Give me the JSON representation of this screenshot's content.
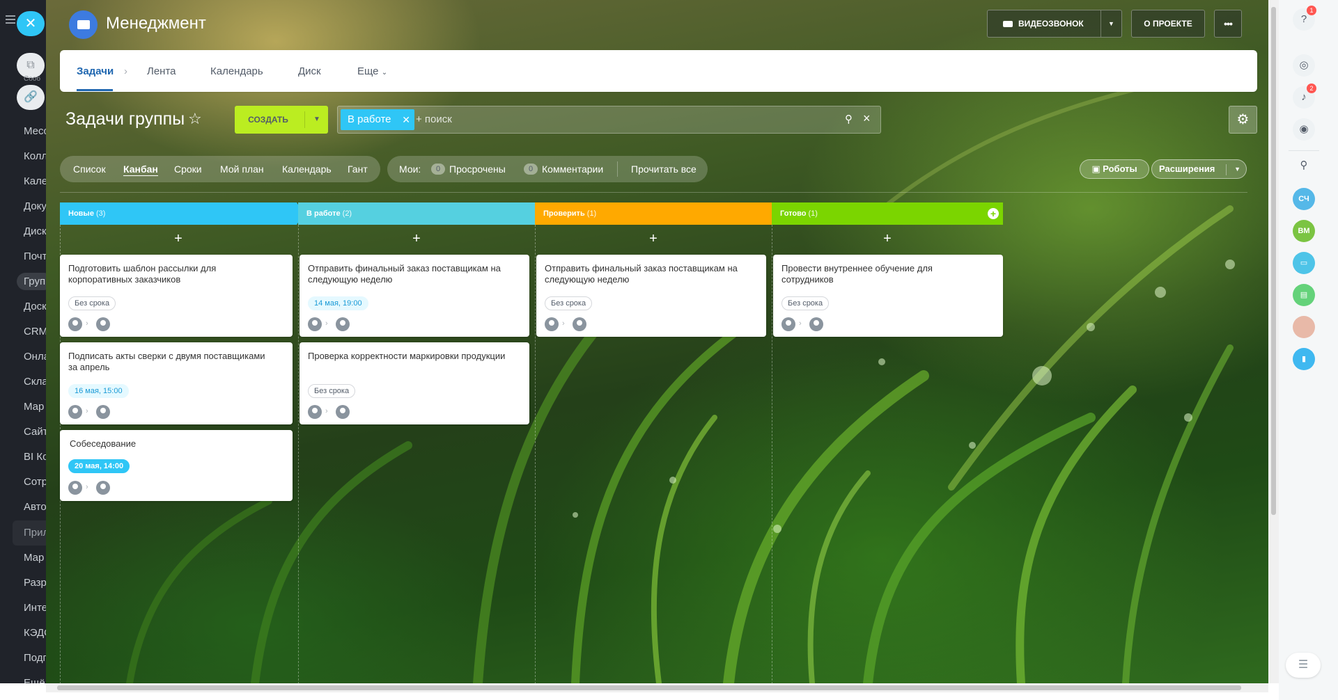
{
  "header": {
    "group_title": "Менеджмент",
    "video_call": "ВИДЕОЗВОНОК",
    "about": "О ПРОЕКТЕ",
    "more": "•••"
  },
  "left_sidebar": {
    "items": [
      "Сооб",
      "Месс",
      "Колл",
      "Кале",
      "Доку",
      "Диск",
      "Почт",
      "Груп",
      "Доск",
      "CRM",
      "Онла",
      "Скла",
      "Мар",
      "Сайт",
      "BI Ко",
      "Сотр",
      "Авто",
      "Прил",
      "Мар",
      "Разр",
      "Инте",
      "КЭДО",
      "Подп",
      "Ещё"
    ]
  },
  "topnav": {
    "tabs": [
      {
        "label": "Задачи"
      },
      {
        "label": "Лента"
      },
      {
        "label": "Календарь"
      },
      {
        "label": "Диск"
      },
      {
        "label": "Еще"
      }
    ]
  },
  "toolbar": {
    "page_title": "Задачи группы",
    "create_label": "СОЗДАТЬ",
    "filter_chip": "В работе",
    "search_placeholder": "+ поиск"
  },
  "views": [
    "Список",
    "Канбан",
    "Сроки",
    "Мой план",
    "Календарь",
    "Гант"
  ],
  "moi": {
    "label": "Мои:",
    "overdue_count": "0",
    "overdue_label": "Просрочены",
    "comments_count": "0",
    "comments_label": "Комментарии",
    "read_all": "Прочитать все"
  },
  "robots_label": "Роботы",
  "extensions_label": "Расширения",
  "columns": [
    {
      "title": "Новые",
      "count": "(3)",
      "color": "#2fc6f6",
      "cards": [
        {
          "title": "Подготовить шаблон рассылки для корпоративных заказчиков",
          "deadline": "Без срока",
          "deadline_style": "none"
        },
        {
          "title": "Подписать акты сверки с двумя поставщиками за апрель",
          "deadline": "16 мая, 15:00",
          "deadline_style": "blue"
        },
        {
          "title": "Собеседование",
          "deadline": "20 мая, 14:00",
          "deadline_style": "teal"
        }
      ]
    },
    {
      "title": "В работе",
      "count": "(2)",
      "color": "#55d0e0",
      "cards": [
        {
          "title": "Отправить финальный заказ поставщикам на следующую неделю",
          "deadline": "14 мая, 19:00",
          "deadline_style": "blue"
        },
        {
          "title": "Проверка корректности маркировки продукции",
          "deadline": "Без срока",
          "deadline_style": "none"
        }
      ]
    },
    {
      "title": "Проверить",
      "count": "(1)",
      "color": "#ffa900",
      "cards": [
        {
          "title": "Отправить финальный заказ поставщикам на следующую неделю",
          "deadline": "Без срока",
          "deadline_style": "none"
        }
      ]
    },
    {
      "title": "Готово",
      "count": "(1)",
      "color": "#7bd500",
      "cards": [
        {
          "title": "Провести внутреннее обучение для сотрудников",
          "deadline": "Без срока",
          "deadline_style": "none"
        }
      ]
    }
  ],
  "right_panel": {
    "help_badge": "1",
    "notify_badge": "2",
    "avatar1": "СЧ",
    "avatar2": "ВМ"
  }
}
